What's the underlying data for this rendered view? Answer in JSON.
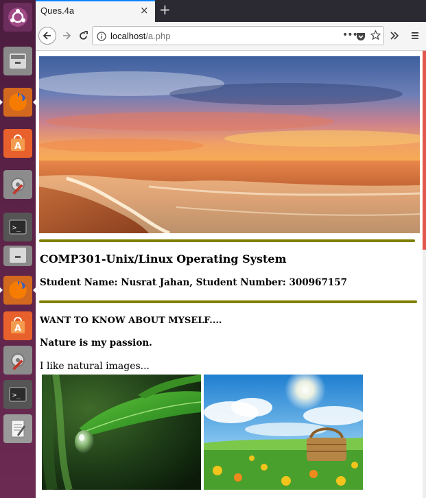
{
  "browser": {
    "tab": {
      "title": "Ques.4a",
      "close": "×"
    },
    "new_tab": "+",
    "url": {
      "host": "localhost",
      "path": "/a.php"
    },
    "toolbar_icons": [
      "back-icon",
      "forward-icon",
      "reload-icon",
      "info-icon",
      "page-actions-icon",
      "pocket-icon",
      "bookmark-star-icon",
      "overflow-icon",
      "menu-icon"
    ]
  },
  "launcher": {
    "items": [
      "ubuntu-dash",
      "files",
      "firefox",
      "software-center",
      "system-settings",
      "terminal",
      "files",
      "firefox",
      "software-center",
      "system-settings",
      "terminal",
      "text-editor"
    ]
  },
  "page": {
    "course_heading": "COMP301-Unix/Linux Operating System",
    "student_heading": "Student Name: Nusrat Jahan, Student Number: 300967157",
    "about_heading": "WANT TO KNOW ABOUT MYSELF....",
    "passion_heading": "Nature is my passion.",
    "intro_text": "I like natural images...",
    "colors": {
      "rule": "#808000"
    },
    "images": [
      "beach-sunset-image",
      "leaf-water-drop-image",
      "picnic-basket-field-image"
    ]
  }
}
